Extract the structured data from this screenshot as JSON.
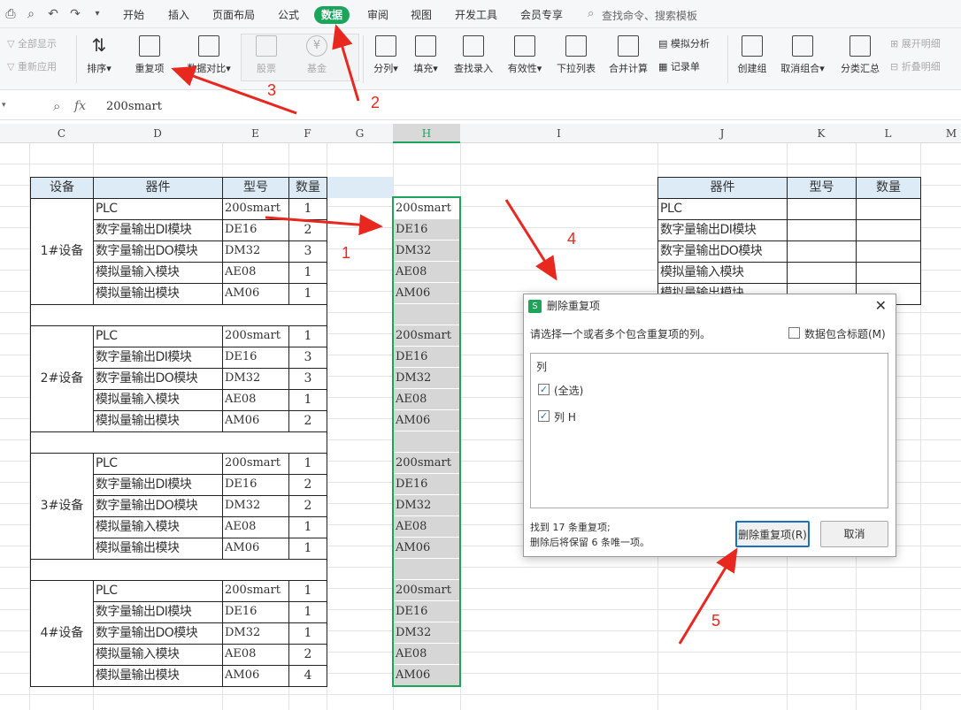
{
  "menu": {
    "tabs": [
      "开始",
      "插入",
      "页面布局",
      "公式",
      "数据",
      "审阅",
      "视图",
      "开发工具",
      "会员专享"
    ],
    "active_tab": "数据",
    "search_placeholder": "查找命令、搜索模板"
  },
  "ribbon": {
    "show_all": "全部显示",
    "reapply": "重新应用",
    "sort": "排序",
    "duplicates": "重复项",
    "data_compare": "数据对比",
    "stocks": "股票",
    "funds": "基金",
    "split": "分列",
    "fill": "填充",
    "find_entry": "查找录入",
    "validity": "有效性",
    "dropdown": "下拉列表",
    "merge_calc": "合并计算",
    "simulate": "模拟分析",
    "record": "记录单",
    "create_group": "创建组",
    "ungroup": "取消组合",
    "subtotal": "分类汇总",
    "expand": "展开明细",
    "collapse": "折叠明细"
  },
  "formula_bar": {
    "fx": "fx",
    "value": "200smart"
  },
  "columns": [
    "C",
    "D",
    "E",
    "F",
    "G",
    "H",
    "I",
    "J",
    "K",
    "L",
    "M"
  ],
  "left_table": {
    "headers": [
      "设备",
      "器件",
      "型号",
      "数量"
    ],
    "groups": [
      {
        "device": "1#设备",
        "rows": [
          [
            "PLC",
            "200smart",
            "1"
          ],
          [
            "数字量输出DI模块",
            "DE16",
            "2"
          ],
          [
            "数字量输出DO模块",
            "DM32",
            "3"
          ],
          [
            "模拟量输入模块",
            "AE08",
            "1"
          ],
          [
            "模拟量输出模块",
            "AM06",
            "1"
          ]
        ]
      },
      {
        "device": "2#设备",
        "rows": [
          [
            "PLC",
            "200smart",
            "1"
          ],
          [
            "数字量输出DI模块",
            "DE16",
            "3"
          ],
          [
            "数字量输出DO模块",
            "DM32",
            "3"
          ],
          [
            "模拟量输入模块",
            "AE08",
            "1"
          ],
          [
            "模拟量输出模块",
            "AM06",
            "2"
          ]
        ]
      },
      {
        "device": "3#设备",
        "rows": [
          [
            "PLC",
            "200smart",
            "1"
          ],
          [
            "数字量输出DI模块",
            "DE16",
            "2"
          ],
          [
            "数字量输出DO模块",
            "DM32",
            "2"
          ],
          [
            "模拟量输入模块",
            "AE08",
            "1"
          ],
          [
            "模拟量输出模块",
            "AM06",
            "1"
          ]
        ]
      },
      {
        "device": "4#设备",
        "rows": [
          [
            "PLC",
            "200smart",
            "1"
          ],
          [
            "数字量输出DI模块",
            "DE16",
            "1"
          ],
          [
            "数字量输出DO模块",
            "DM32",
            "1"
          ],
          [
            "模拟量输入模块",
            "AE08",
            "2"
          ],
          [
            "模拟量输出模块",
            "AM06",
            "4"
          ]
        ]
      }
    ]
  },
  "column_h": [
    "200smart",
    "DE16",
    "DM32",
    "AE08",
    "AM06",
    "",
    "200smart",
    "DE16",
    "DM32",
    "AE08",
    "AM06",
    "",
    "200smart",
    "DE16",
    "DM32",
    "AE08",
    "AM06",
    "",
    "200smart",
    "DE16",
    "DM32",
    "AE08",
    "AM06"
  ],
  "right_table": {
    "headers": [
      "器件",
      "型号",
      "数量"
    ],
    "rows": [
      "PLC",
      "数字量输出DI模块",
      "数字量输出DO模块",
      "模拟量输入模块",
      "模拟量输出模块"
    ]
  },
  "dialog": {
    "title": "删除重复项",
    "prompt": "请选择一个或者多个包含重复项的列。",
    "has_header_label": "数据包含标题(M)",
    "list_header": "列",
    "select_all": "(全选)",
    "col_h": "列 H",
    "found": "找到 17 条重复项;",
    "keep": "删除后将保留 6 条唯一项。",
    "delete_btn": "删除重复项(R)",
    "cancel_btn": "取消"
  },
  "annotations": [
    "1",
    "2",
    "3",
    "4",
    "5"
  ],
  "colors": {
    "accent": "#1aa55b",
    "arrow": "#e8281f",
    "header_fill": "#ddebf7",
    "selected_fill": "#d6d6d6"
  }
}
